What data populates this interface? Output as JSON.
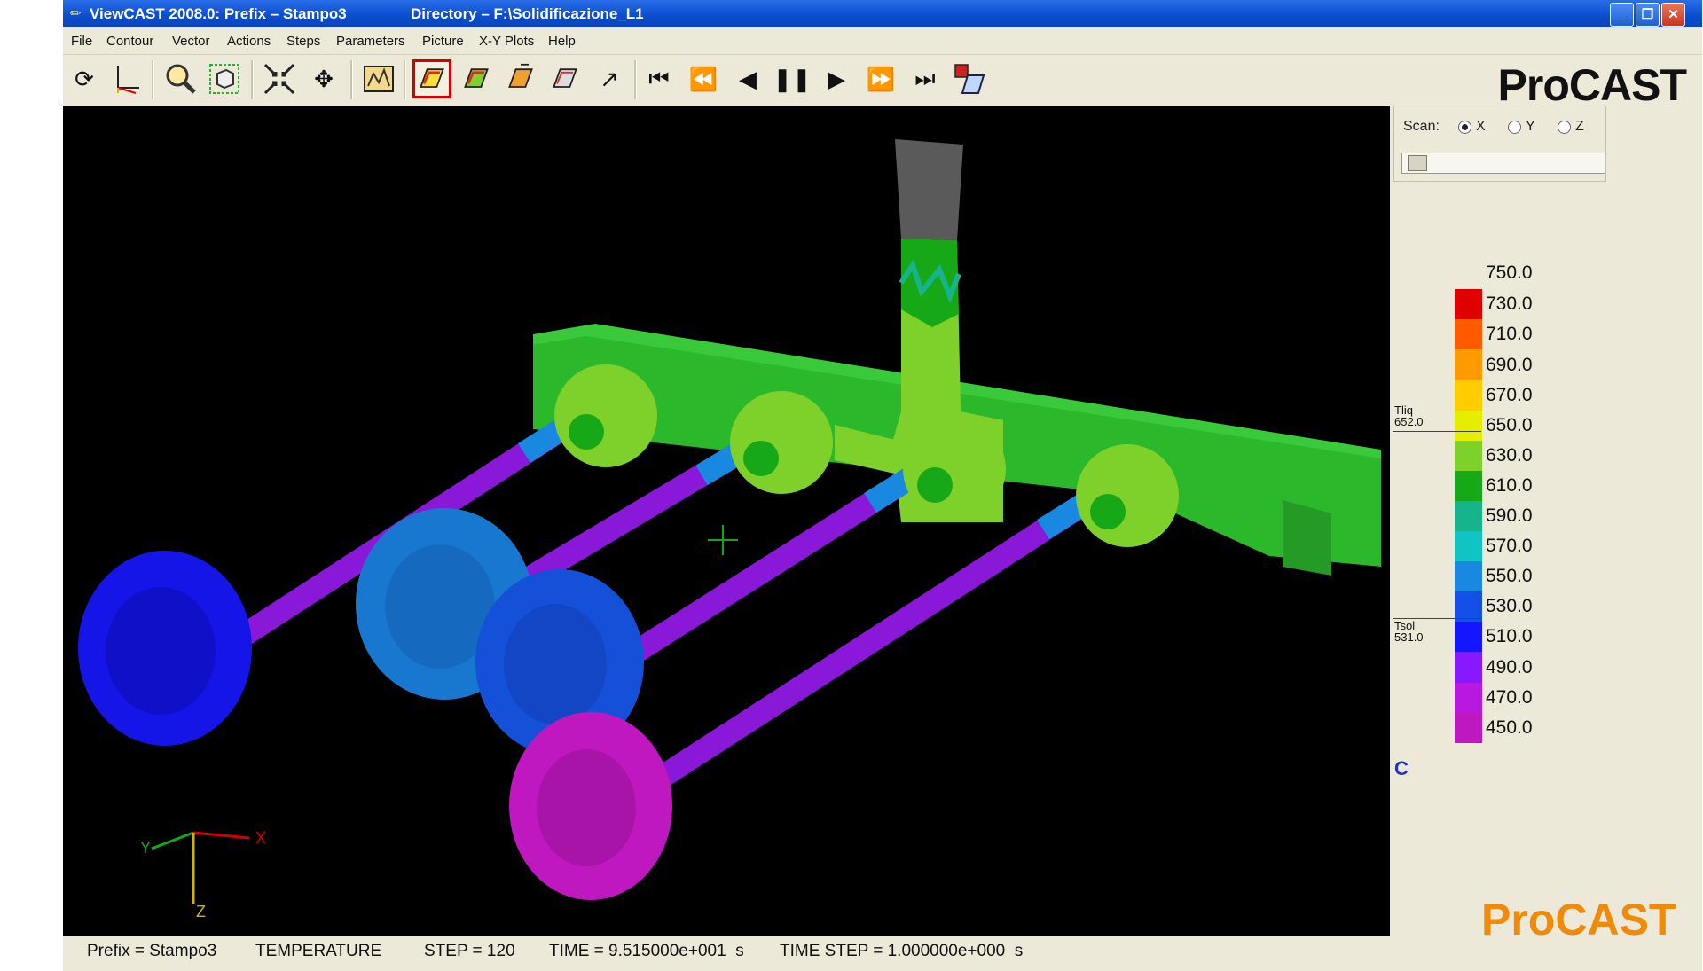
{
  "window": {
    "title": "ViewCAST 2008.0: Prefix – Stampo3",
    "directory": "Directory – F:\\Solidificazione_L1"
  },
  "menu": [
    "File",
    "Contour",
    "Vector",
    "Actions",
    "Steps",
    "Parameters",
    "Picture",
    "X-Y Plots",
    "Help"
  ],
  "toolbar": {
    "brand": "ProCAST",
    "icons": [
      "rotate-icon",
      "axes-icon",
      "zoom-icon",
      "box-zoom-icon",
      "fit-icon",
      "pan-icon",
      "result-icon",
      "contour-icon",
      "vector-icon",
      "isosurface-icon",
      "cut-icon",
      "probe-icon",
      "first-step-icon",
      "rewind-icon",
      "step-back-icon",
      "pause-icon",
      "play-icon",
      "fast-forward-icon",
      "last-step-icon",
      "save-animation-icon"
    ]
  },
  "scan": {
    "label": "Scan:",
    "options": [
      "X",
      "Y",
      "Z"
    ],
    "selected": "X"
  },
  "legend": {
    "max": "750.0",
    "entries": [
      {
        "value": "730.0",
        "color": "#e00000"
      },
      {
        "value": "710.0",
        "color": "#ff5a00"
      },
      {
        "value": "690.0",
        "color": "#ff9a00"
      },
      {
        "value": "670.0",
        "color": "#ffcc00"
      },
      {
        "value": "650.0",
        "color": "#e6ee00"
      },
      {
        "value": "630.0",
        "color": "#7ed12a"
      },
      {
        "value": "610.0",
        "color": "#16a816"
      },
      {
        "value": "590.0",
        "color": "#15b48c"
      },
      {
        "value": "570.0",
        "color": "#10c4c4"
      },
      {
        "value": "550.0",
        "color": "#1888e0"
      },
      {
        "value": "530.0",
        "color": "#1450e8"
      },
      {
        "value": "510.0",
        "color": "#1515ff"
      },
      {
        "value": "490.0",
        "color": "#8a18ff"
      },
      {
        "value": "470.0",
        "color": "#b818e0"
      },
      {
        "value": "450.0",
        "color": "#c018c0"
      }
    ],
    "tliq_label": "Tliq",
    "tliq_value": "652.0",
    "tsol_label": "Tsol",
    "tsol_value": "531.0",
    "unit": "C"
  },
  "axes": {
    "x": "X",
    "y": "Y",
    "z": "Z"
  },
  "status": {
    "prefix": "Prefix = Stampo3",
    "field": "TEMPERATURE",
    "step": "STEP = 120",
    "time": "TIME = 9.515000e+001  s",
    "time_step": "TIME STEP = 1.000000e+000  s"
  },
  "watermark": "ProCAST"
}
